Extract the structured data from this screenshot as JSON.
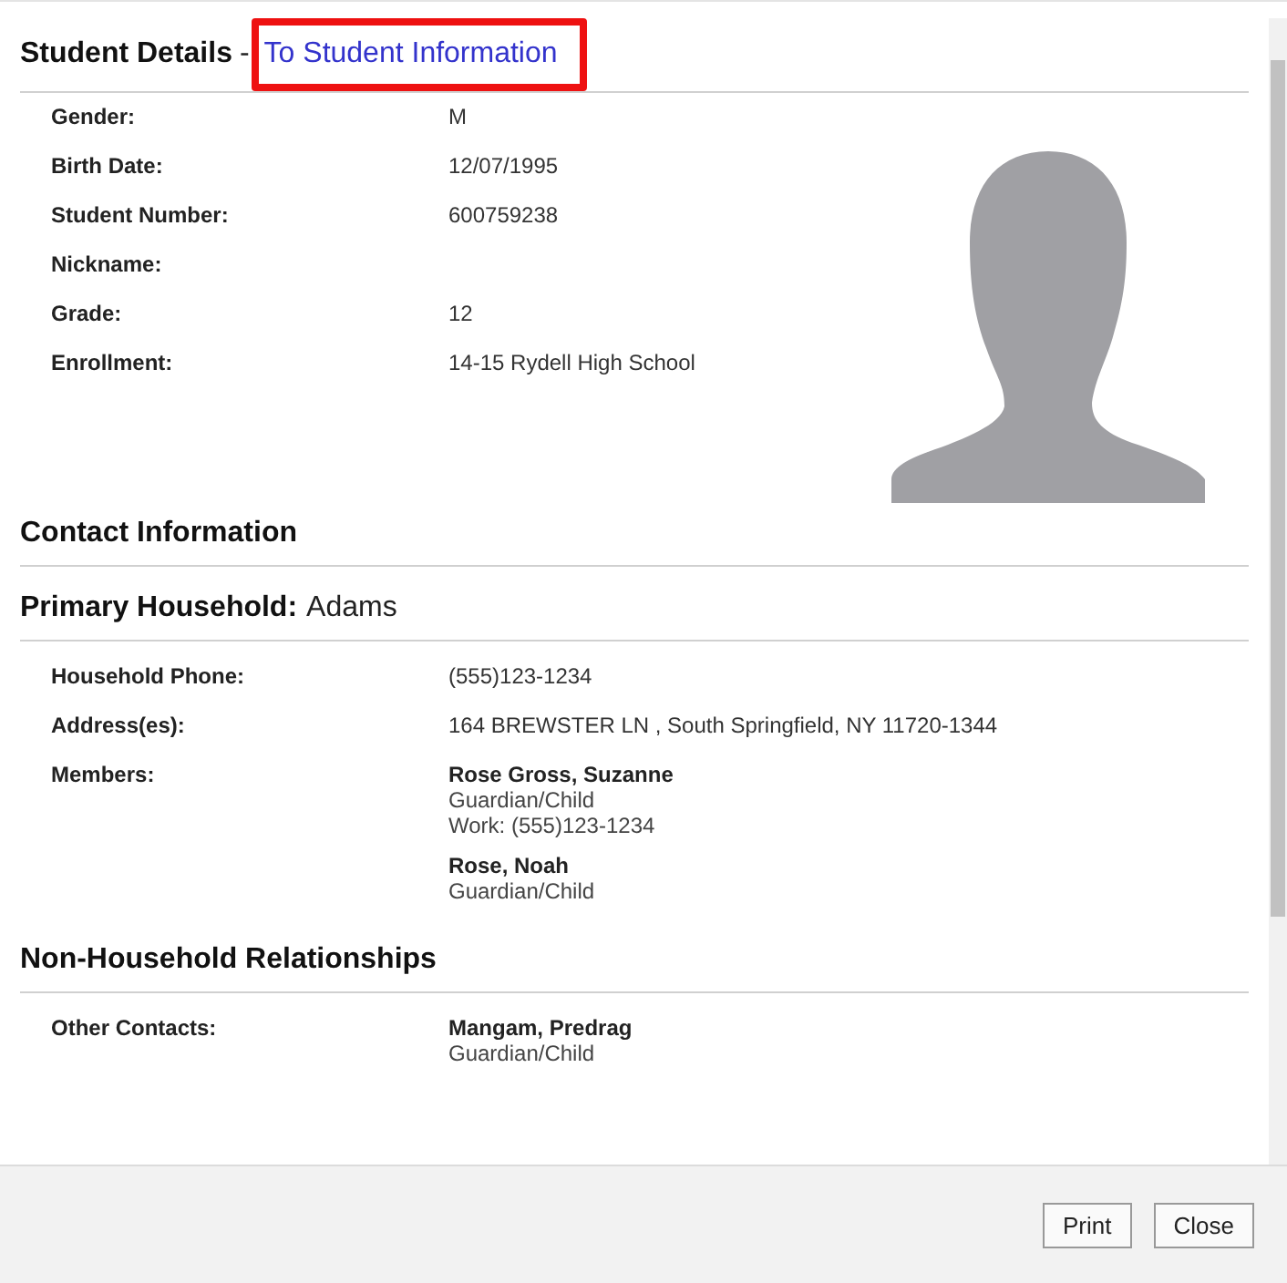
{
  "student_details": {
    "title": "Student Details",
    "separator": "-",
    "link": {
      "label": "To Student Information",
      "highlighted": true
    },
    "fields": [
      {
        "label": "Gender:",
        "value": "M"
      },
      {
        "label": "Birth Date:",
        "value": "12/07/1995"
      },
      {
        "label": "Student Number:",
        "value": "600759238"
      },
      {
        "label": "Nickname:"
      },
      {
        "label": "Grade:",
        "value": "12"
      },
      {
        "label": "Enrollment:",
        "value": "14-15 Rydell High School"
      }
    ]
  },
  "contact_information": {
    "title": "Contact Information"
  },
  "primary_household": {
    "title": "Primary Household:",
    "name": "Adams",
    "phone": {
      "label": "Household Phone:",
      "value": "(555)123-1234"
    },
    "address": {
      "label": "Address(es):",
      "value": "164 BREWSTER LN , South Springfield, NY 11720-1344"
    },
    "members": {
      "label": "Members:",
      "people": [
        {
          "name": "Rose Gross, Suzanne",
          "role": "Guardian/Child",
          "phone": "Work: (555)123-1234"
        },
        {
          "name": "Rose, Noah",
          "role": "Guardian/Child"
        }
      ]
    }
  },
  "non_household": {
    "title": "Non-Household Relationships",
    "other_contacts": {
      "label": "Other Contacts:",
      "people": [
        {
          "name": "Mangam, Predrag",
          "role": "Guardian/Child"
        }
      ]
    }
  },
  "buttons": [
    {
      "label": "Print"
    },
    {
      "label": "Close"
    }
  ]
}
